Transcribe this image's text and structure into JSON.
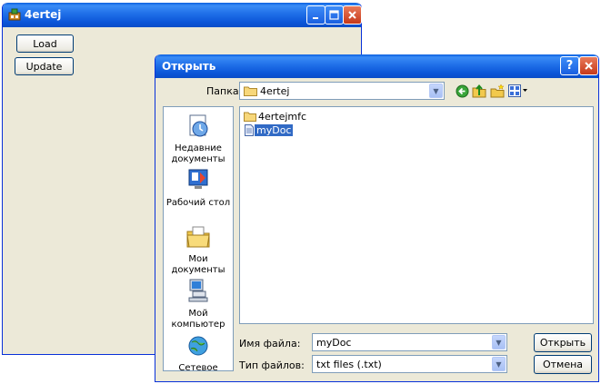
{
  "app": {
    "title": "4ertej",
    "buttons": {
      "load": "Load",
      "update": "Update"
    },
    "controls": {
      "minimize": "minimize-icon",
      "maximize": "maximize-icon",
      "close": "close-icon"
    }
  },
  "dialog": {
    "title": "Открыть",
    "lookin_label": "Папка:",
    "lookin_value": "4ertej",
    "places": [
      {
        "label": "Недавние документы",
        "icon": "recent-documents-icon"
      },
      {
        "label": "Рабочий стол",
        "icon": "desktop-icon"
      },
      {
        "label": "Мои документы",
        "icon": "my-documents-icon"
      },
      {
        "label": "Мой компьютер",
        "icon": "my-computer-icon"
      },
      {
        "label": "Сетевое",
        "icon": "network-icon"
      }
    ],
    "files": [
      {
        "name": "4ertejmfc",
        "type": "folder"
      },
      {
        "name": "myDoc",
        "type": "file",
        "selected": true
      }
    ],
    "filename_label": "Имя файла:",
    "filename_value": "myDoc",
    "filetype_label": "Тип файлов:",
    "filetype_value": "txt files (.txt)",
    "open_button": "Открыть",
    "cancel_button": "Отмена",
    "help_button": "?"
  }
}
